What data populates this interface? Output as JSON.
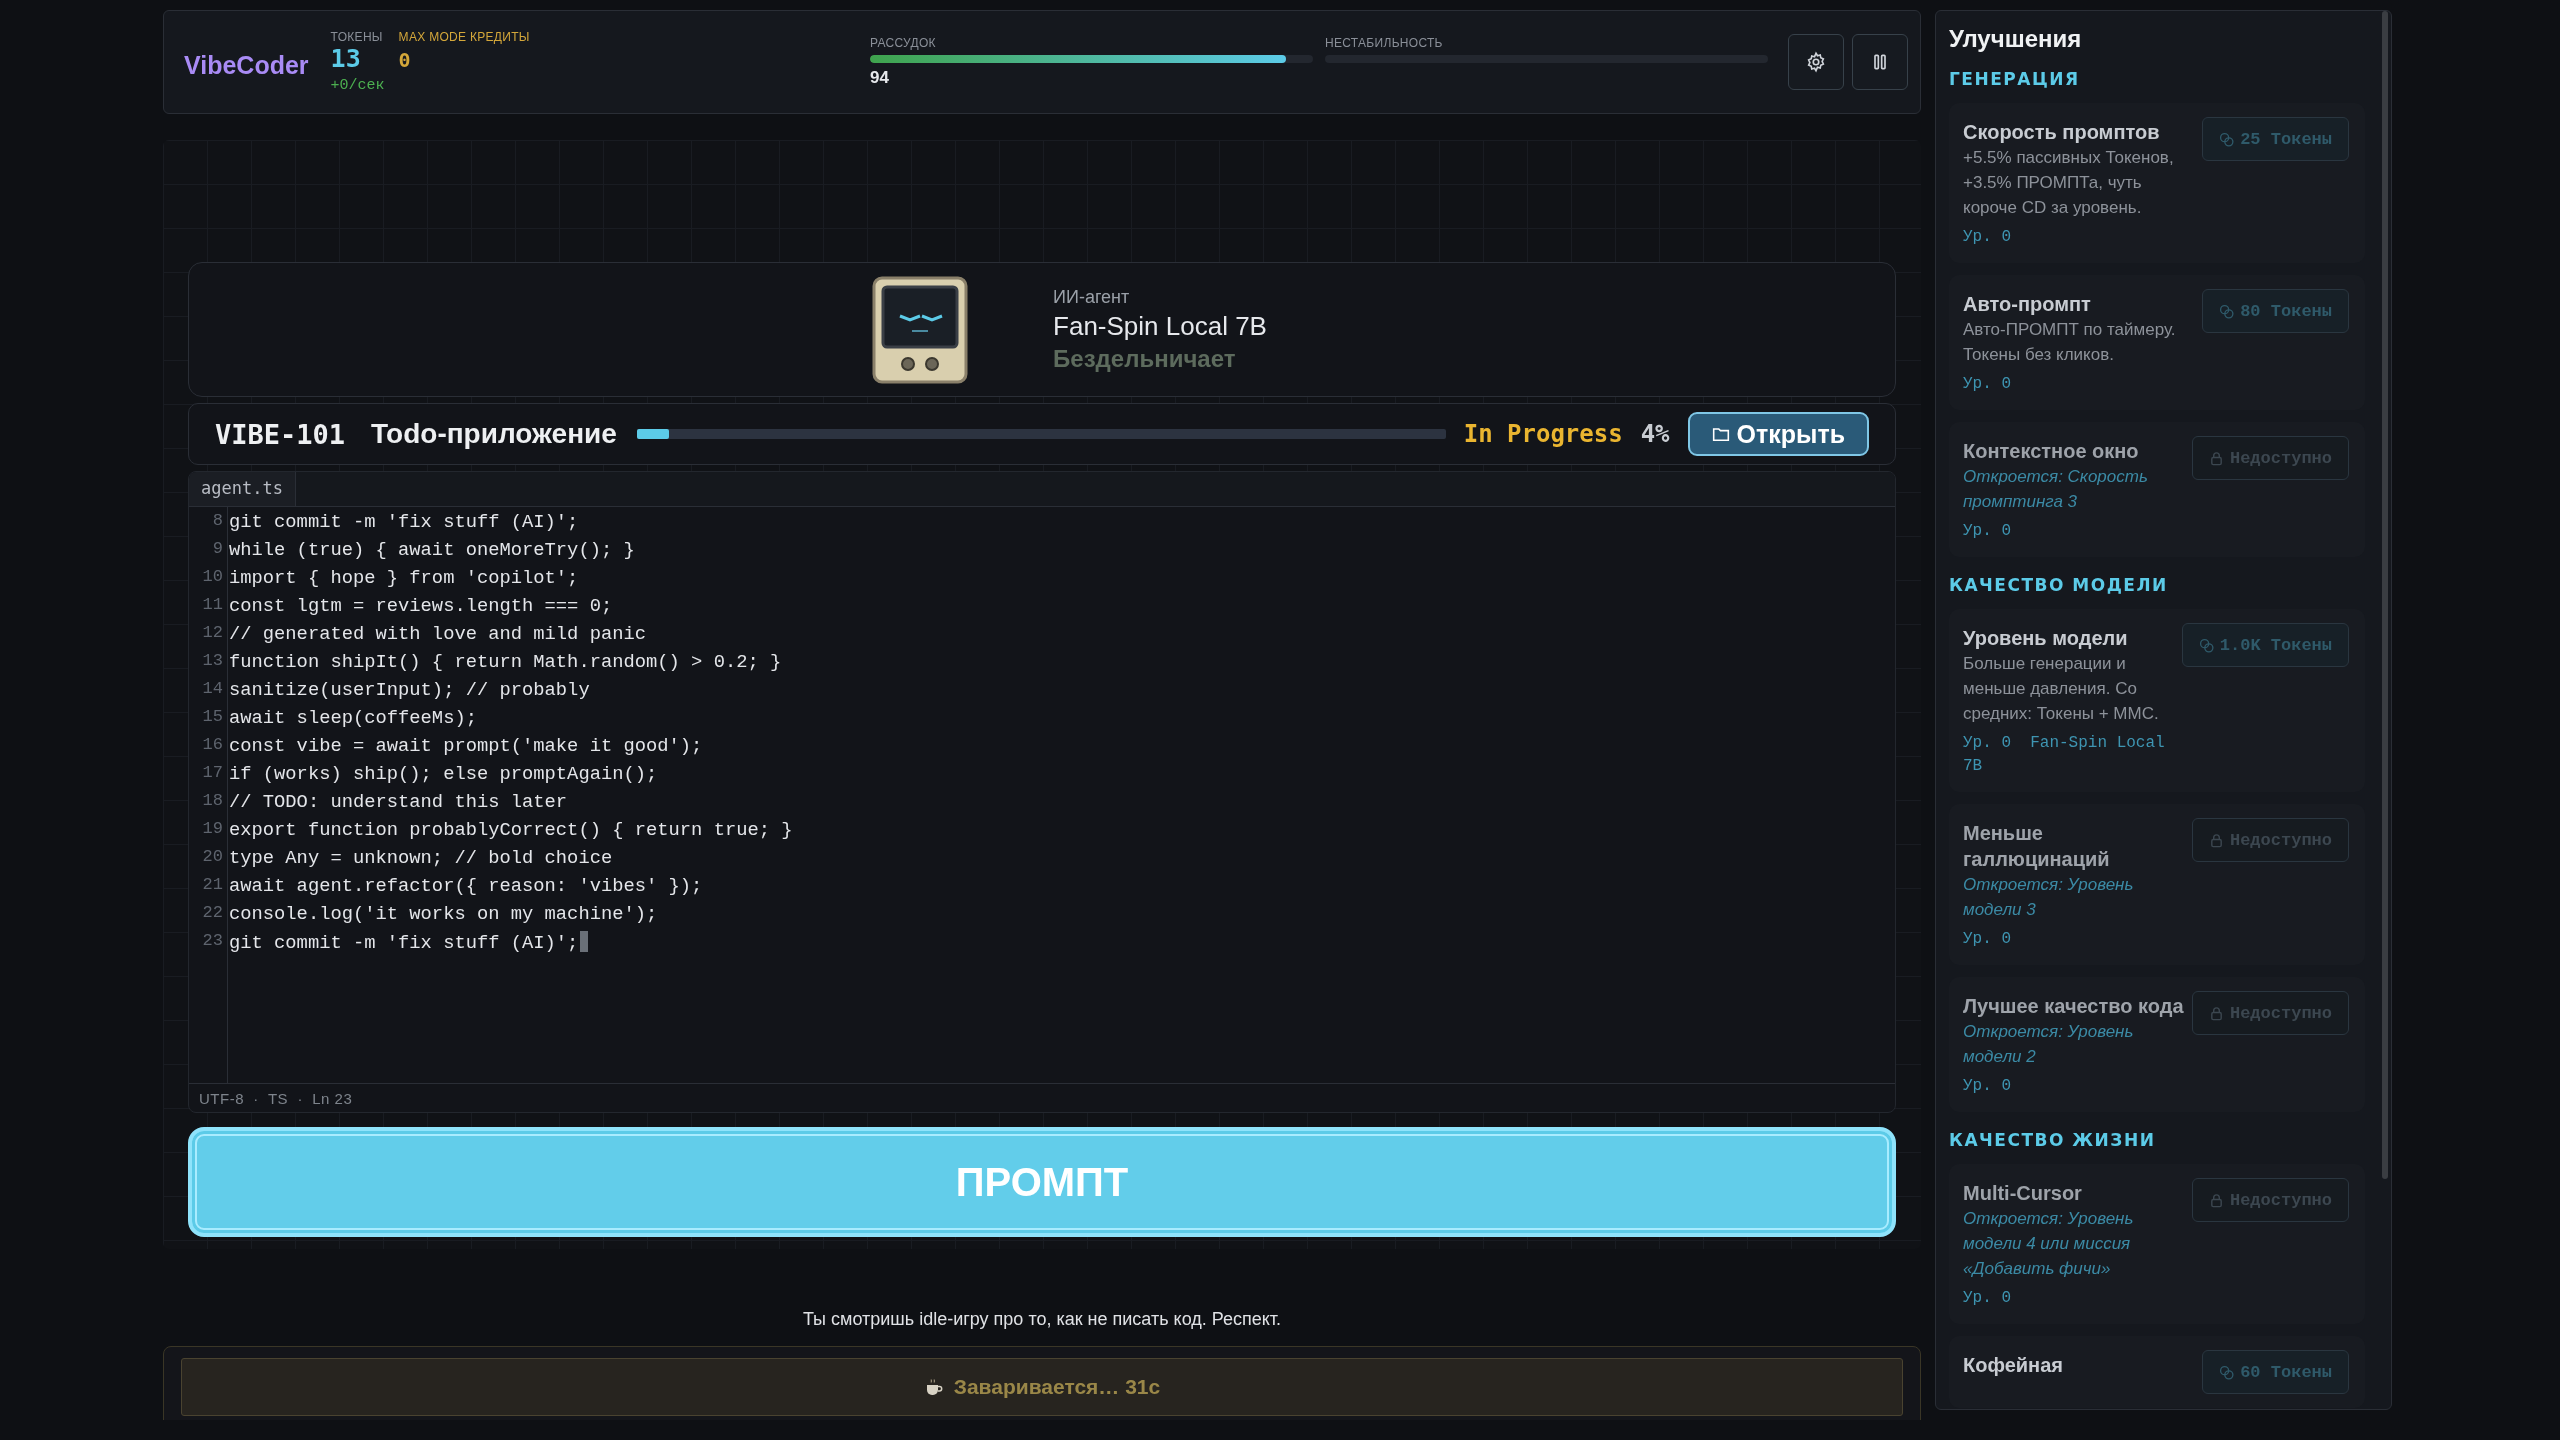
{
  "header": {
    "logo": "VibeCoder",
    "tokens": {
      "label": "ТОКЕНЫ",
      "value": "13",
      "rate": "+0/сек"
    },
    "credits": {
      "label": "MAX MODE КРЕДИТЫ",
      "value": "0"
    },
    "meters": [
      {
        "label": "РАССУДОК",
        "level": 0.94,
        "reading": "94"
      },
      {
        "label": "НЕСТАБИЛЬНОСТЬ",
        "level": 0
      }
    ]
  },
  "agent": {
    "role": "ИИ-агент",
    "name": "Fan-Spin Local 7B",
    "status": "Бездельничает"
  },
  "task": {
    "id": "VIBE-101",
    "title": "Todo-приложение",
    "level": 0.04,
    "status": "In Progress",
    "percent": "4%",
    "open_button": "Открыть"
  },
  "editor": {
    "tab": "agent.ts",
    "cursor": true,
    "lines": [
      {
        "number": "8",
        "code": "git commit -m 'fix stuff (AI)';"
      },
      {
        "number": "9",
        "code": "while (true) { await oneMoreTry(); }"
      },
      {
        "number": "10",
        "code": "import { hope } from 'copilot';"
      },
      {
        "number": "11",
        "code": "const lgtm = reviews.length === 0;"
      },
      {
        "number": "12",
        "code": "// generated with love and mild panic"
      },
      {
        "number": "13",
        "code": "function shipIt() { return Math.random() > 0.2; }"
      },
      {
        "number": "14",
        "code": "sanitize(userInput); // probably"
      },
      {
        "number": "15",
        "code": "await sleep(coffeeMs);"
      },
      {
        "number": "16",
        "code": "const vibe = await prompt('make it good');"
      },
      {
        "number": "17",
        "code": "if (works) ship(); else promptAgain();"
      },
      {
        "number": "18",
        "code": "// TODO: understand this later"
      },
      {
        "number": "19",
        "code": "export function probablyCorrect() { return true; }"
      },
      {
        "number": "20",
        "code": "type Any = unknown; // bold choice"
      },
      {
        "number": "21",
        "code": "await agent.refactor({ reason: 'vibes' });"
      },
      {
        "number": "22",
        "code": "console.log('it works on my machine');"
      },
      {
        "number": "23",
        "code": "git commit -m 'fix stuff (AI)';"
      }
    ],
    "status": "UTF-8  ·  TS  ·  Ln 23"
  },
  "prompt_button": "ПРОМПТ",
  "tagline": "Ты смотришь idle-игру про то, как не писать код. Респект.",
  "brewing": "Заваривается… 31с",
  "upgrades": {
    "title": "Улучшения",
    "sections": [
      {
        "title": "ГЕНЕРАЦИЯ",
        "items": [
          {
            "kind": "available",
            "title": "Скорость промптов",
            "description": "+5.5% пассивных Токенов, +3.5% ПРОМПТа, чуть короче CD за уровень.",
            "level": "Ур. 0",
            "cost": "25 Токены"
          },
          {
            "kind": "available",
            "title": "Авто-промпт",
            "description": "Авто-ПРОМПТ по таймеру. Токены без кликов.",
            "level": "Ур. 0",
            "cost": "80 Токены"
          },
          {
            "kind": "locked",
            "title": "Контекстное окно",
            "unlock": "Откроется: Скорость промптинга 3",
            "level": "Ур. 0",
            "cost": "Недоступно"
          }
        ]
      },
      {
        "title": "КАЧЕСТВО МОДЕЛИ",
        "items": [
          {
            "kind": "available",
            "title": "Уровень модели",
            "description": "Больше генерации и меньше давления. Со средних: Токены + ММС.",
            "level": "Ур. 0",
            "extra": "Fan-Spin Local 7B",
            "cost": "1.0K Токены"
          },
          {
            "kind": "locked",
            "title": "Меньше галлюцинаций",
            "unlock": "Откроется: Уровень модели 3",
            "level": "Ур. 0",
            "cost": "Недоступно"
          },
          {
            "kind": "locked",
            "title": "Лучшее качество кода",
            "unlock": "Откроется: Уровень модели 2",
            "level": "Ур. 0",
            "cost": "Недоступно"
          }
        ]
      },
      {
        "title": "КАЧЕСТВО ЖИЗНИ",
        "items": [
          {
            "kind": "locked",
            "title": "Multi-Cursor",
            "unlock": "Откроется: Уровень модели 4 или миссия «Добавить фичи»",
            "level": "Ур. 0",
            "cost": "Недоступно"
          },
          {
            "kind": "available",
            "title": "Кофейная",
            "cost": "60 Токены"
          }
        ]
      }
    ]
  }
}
